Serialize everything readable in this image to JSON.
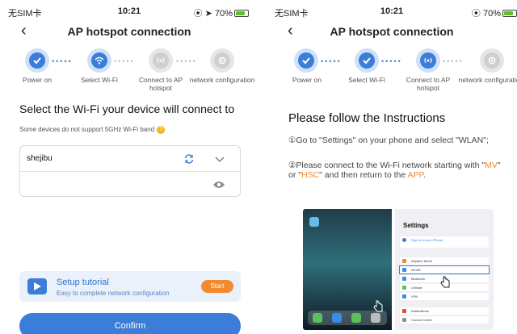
{
  "left": {
    "status": {
      "carrier": "无SIM卡",
      "time": "10:21",
      "battery": "70%"
    },
    "title": "AP hotspot connection",
    "steps": [
      "Power on",
      "Select Wi-Fi",
      "Connect to AP hotspot",
      "network configuration"
    ],
    "heading": "Select the Wi-Fi your device will connect to",
    "note": "Some devices do not support 5GHz Wi-Fi band",
    "ssid": "shejibu",
    "password_value": "",
    "tutorial_title": "Setup tutorial",
    "tutorial_sub": "Easy to complete network configuration",
    "start_label": "Start",
    "confirm_label": "Confirm"
  },
  "right": {
    "status": {
      "carrier": "无SIM卡",
      "time": "10:21",
      "battery": "70%"
    },
    "title": "AP hotspot connection",
    "steps": [
      "Power on",
      "Select Wi-Fi",
      "Connect to AP hotspot",
      "network configuration"
    ],
    "instr_title": "Please follow the Instructions",
    "instr1": "①Go to \"Settings\" on your phone and select \"WLAN\";",
    "instr2_a": "②Please connect to the Wi-Fi network starting with \"",
    "instr2_mv": "MV",
    "instr2_b": "\" or \"",
    "instr2_hsc": "HSC",
    "instr2_c": "\" and then return to the ",
    "instr2_app": "APP",
    "instr2_d": ".",
    "screenshot": {
      "settings_title": "Settings",
      "rows": [
        "Sign in to your iPhone",
        "Airplane Mode",
        "WLAN",
        "Bluetooth",
        "Cellular",
        "VPN",
        "Notifications",
        "Control Center"
      ]
    }
  },
  "colors": {
    "accent": "#3b7dd8",
    "orange": "#f08b2f",
    "yellow": "#f5b51b"
  }
}
